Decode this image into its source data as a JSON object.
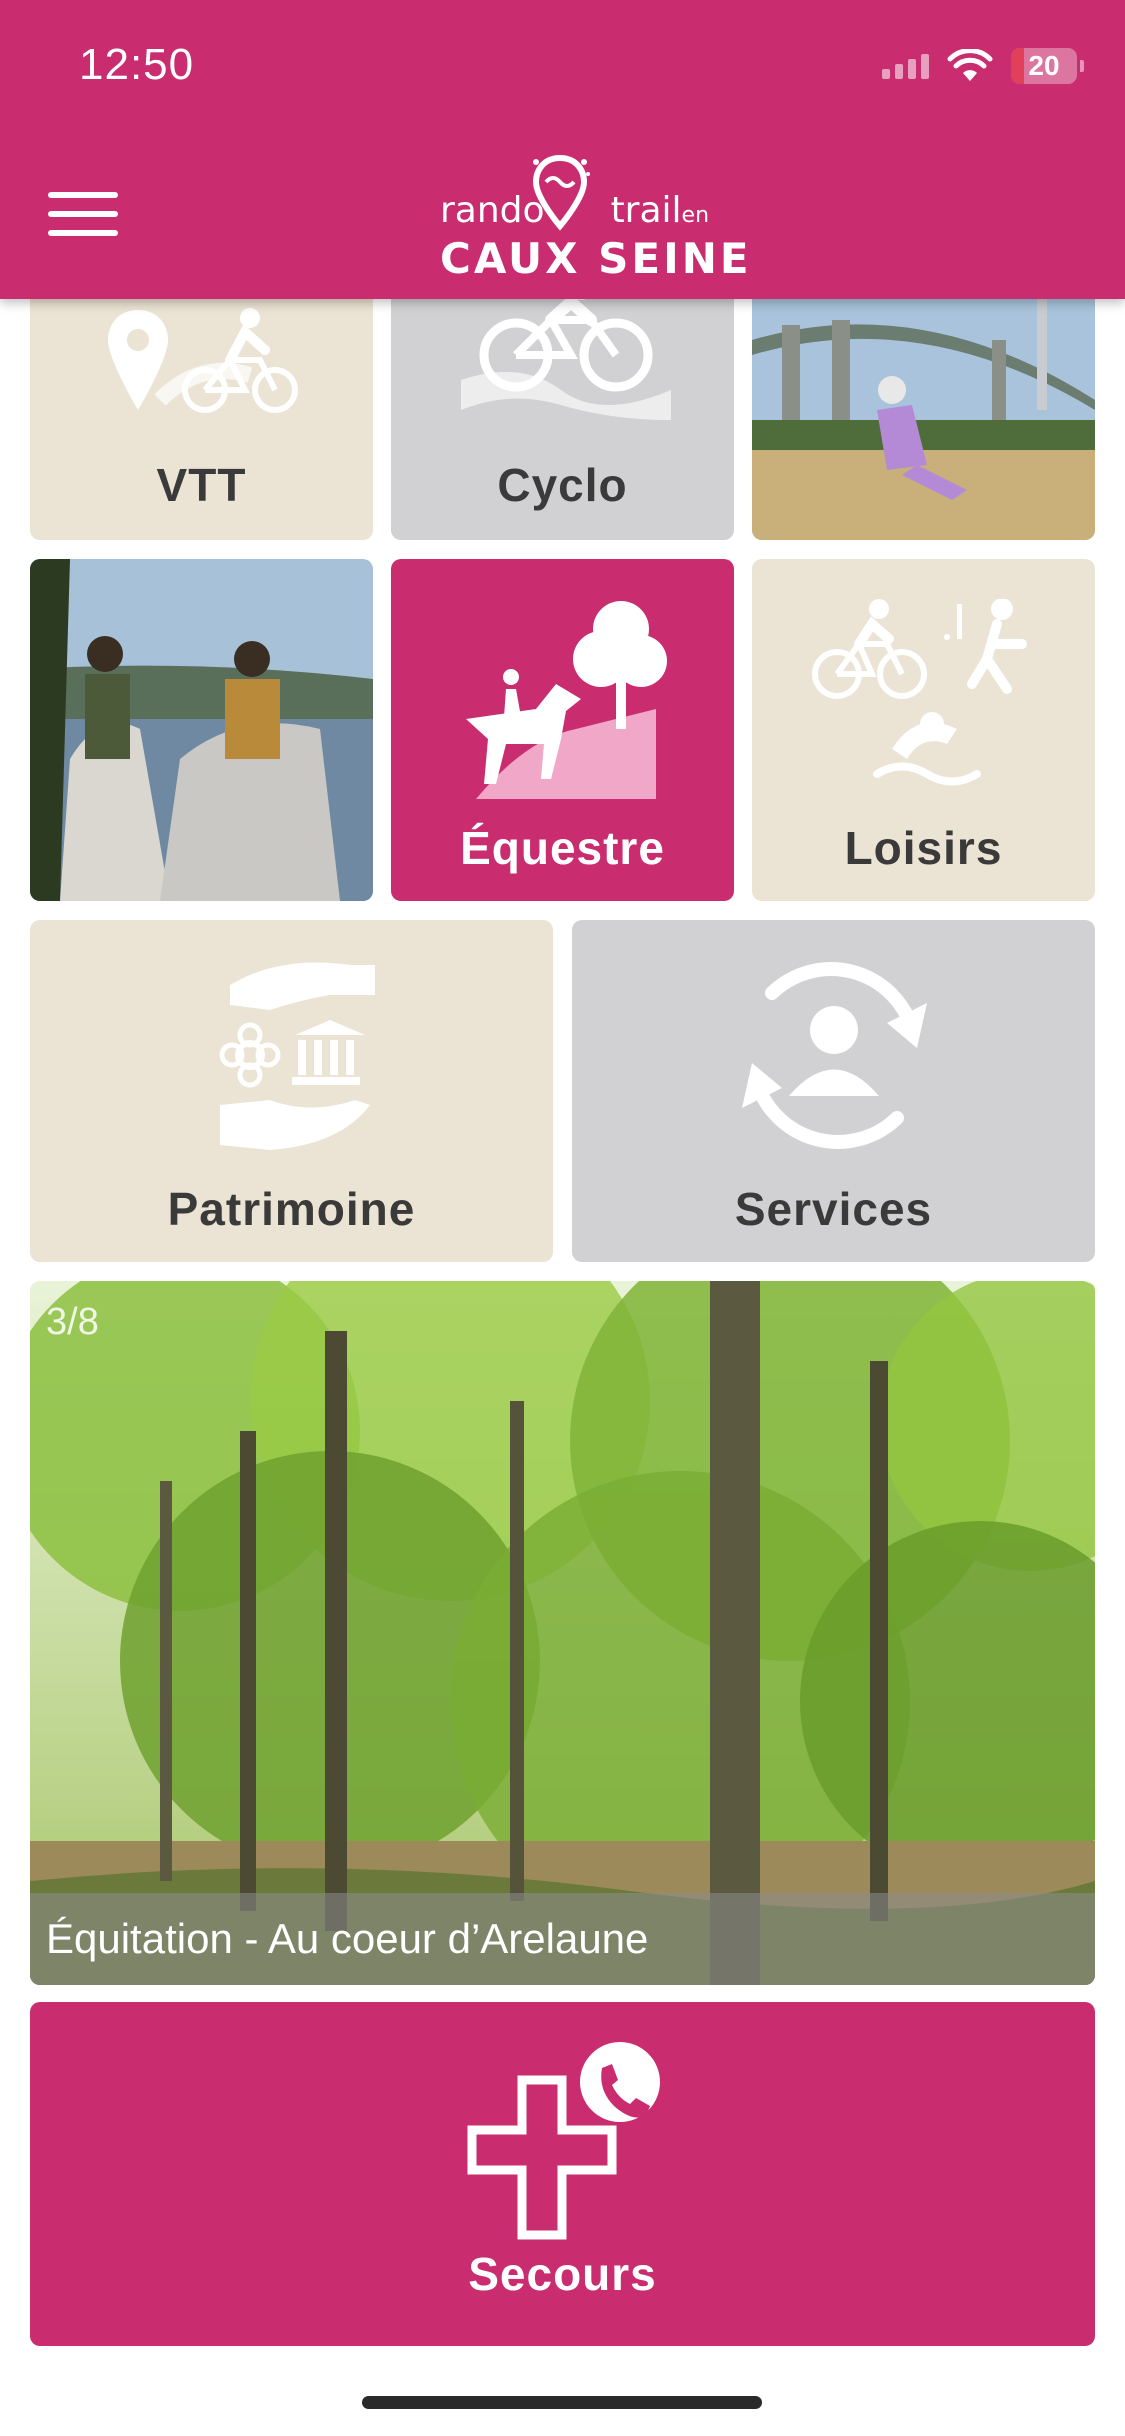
{
  "status_bar": {
    "time": "12:50",
    "battery": "20",
    "battery_level": 0.2
  },
  "header": {
    "logo_rando": "rando",
    "logo_trail": "trail",
    "logo_en": "en",
    "logo_caux_seine": "CAUX SEINE"
  },
  "tiles": {
    "vtt": {
      "label": "VTT",
      "icon": "map-pin-bike-icon"
    },
    "cyclo": {
      "label": "Cyclo",
      "icon": "road-bike-icon"
    },
    "equestre": {
      "label": "Équestre",
      "icon": "horse-rider-icon"
    },
    "loisirs": {
      "label": "Loisirs",
      "icon": "leisure-sports-icon"
    },
    "patrimoine": {
      "label": "Patrimoine",
      "icon": "heritage-hands-icon"
    },
    "services": {
      "label": "Services",
      "icon": "user-sync-icon"
    },
    "secours": {
      "label": "Secours",
      "icon": "medical-cross-phone-icon"
    }
  },
  "carousel": {
    "counter": "3/8",
    "caption": "Équitation - Au coeur d’Arelaune"
  },
  "colors": {
    "brand_pink": "#c92d6f",
    "beige": "#ebe3d3",
    "grey": "#d1d1d3",
    "label_dark": "#3a3a3a"
  }
}
